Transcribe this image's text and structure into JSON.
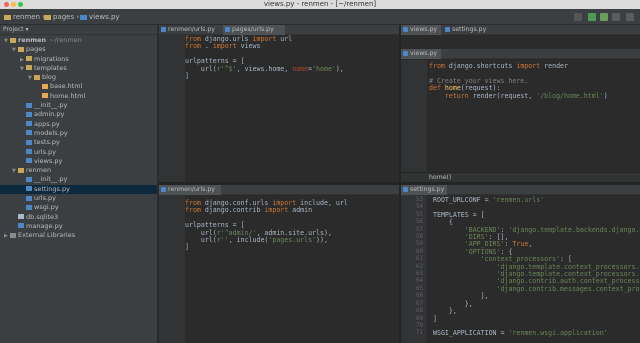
{
  "window": {
    "title": "views.py - renmen - [~/renmen]"
  },
  "breadcrumb": [
    {
      "label": "renmen"
    },
    {
      "label": "pages"
    },
    {
      "label": "views.py"
    }
  ],
  "sidebar": {
    "header": "Project",
    "items": [
      {
        "label": "renmen",
        "suffix": "~/renmen",
        "depth": 0,
        "type": "folder",
        "open": true
      },
      {
        "label": "pages",
        "depth": 1,
        "type": "folder",
        "open": true
      },
      {
        "label": "migrations",
        "depth": 2,
        "type": "folder",
        "open": false
      },
      {
        "label": "templates",
        "depth": 2,
        "type": "folder",
        "open": true
      },
      {
        "label": "blog",
        "depth": 3,
        "type": "folder",
        "open": true
      },
      {
        "label": "base.html",
        "depth": 4,
        "type": "html"
      },
      {
        "label": "home.html",
        "depth": 4,
        "type": "html"
      },
      {
        "label": "__init__.py",
        "depth": 2,
        "type": "py"
      },
      {
        "label": "admin.py",
        "depth": 2,
        "type": "py"
      },
      {
        "label": "apps.py",
        "depth": 2,
        "type": "py"
      },
      {
        "label": "models.py",
        "depth": 2,
        "type": "py"
      },
      {
        "label": "tests.py",
        "depth": 2,
        "type": "py"
      },
      {
        "label": "urls.py",
        "depth": 2,
        "type": "py"
      },
      {
        "label": "views.py",
        "depth": 2,
        "type": "py"
      },
      {
        "label": "renmen",
        "depth": 1,
        "type": "folder",
        "open": true
      },
      {
        "label": "__init__.py",
        "depth": 2,
        "type": "py"
      },
      {
        "label": "settings.py",
        "depth": 2,
        "type": "py",
        "selected": true
      },
      {
        "label": "urls.py",
        "depth": 2,
        "type": "py"
      },
      {
        "label": "wsgi.py",
        "depth": 2,
        "type": "py"
      },
      {
        "label": "db.sqlite3",
        "depth": 1,
        "type": "db"
      },
      {
        "label": "manage.py",
        "depth": 1,
        "type": "py"
      },
      {
        "label": "External Libraries",
        "depth": 0,
        "type": "lib",
        "open": false
      }
    ]
  },
  "panes": {
    "top_left": {
      "tabs": [
        "renmen/urls.py",
        "pages/urls.py"
      ]
    },
    "top_right": {
      "tabs": [
        "views.py",
        "settings.py"
      ],
      "popup_tab": "views.py",
      "breadcrumb": "home()"
    },
    "bottom_left": {
      "tabs": [
        "renmen/urls.py"
      ]
    },
    "bottom_right": {
      "tabs": [
        "settings.py"
      ]
    }
  },
  "colors": {
    "keyword": "#cc7832",
    "string": "#6a8759",
    "comment": "#808080",
    "background": "#2b2b2b",
    "selection": "#0d293e"
  }
}
